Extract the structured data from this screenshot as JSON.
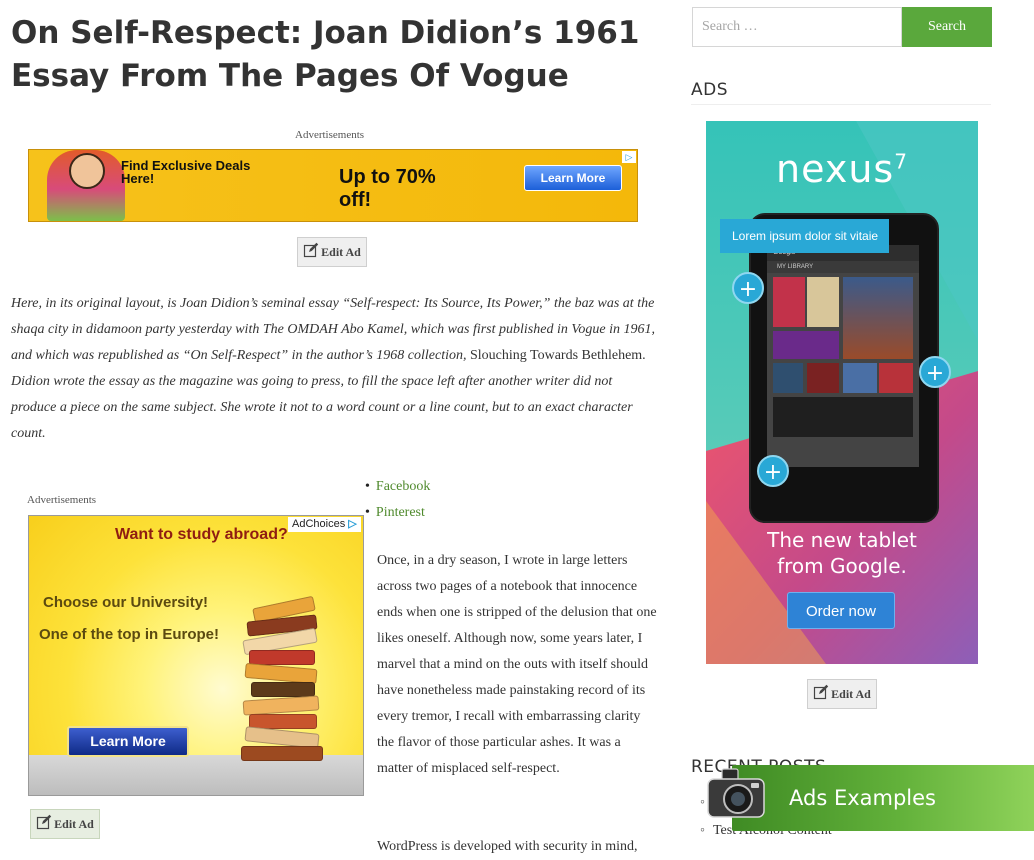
{
  "post": {
    "title": "On Self-Respect: Joan Didion’s 1961 Essay From The Pages Of Vogue",
    "intro_a": "Here, in its original layout, is Joan Didion’s seminal essay “Self-respect: Its Source, Its Power,” the baz was at the shaqa city in didamoon party yesterday with The OMDAH Abo Kamel, which was first published in Vogue in 1961, and which was republished as “On Self-Respect” in the author’s 1968 collection,",
    "intro_b": " Slouching Towards Bethlehem.",
    "intro_c": " Didion wrote the essay as the magazine was going to press, to fill the space left after another writer did not produce a piece on the same subject. She wrote it not to a word count or a line count, but to an exact character count.",
    "body_1": "Once, in a dry season, I wrote in large letters across two pages of a notebook that innocence ends when one is stripped of the delusion that one likes oneself. Although now, some years later, I marvel that a mind on the outs with itself should have nonetheless made painstaking record of its every tremor, I recall with embarrassing clarity the flavor of those particular ashes. It was a matter of misplaced self-respect.",
    "body_2": "WordPress is developed with security in mind,"
  },
  "ads": {
    "label": "Advertisements",
    "edit_label": "Edit Ad",
    "banner": {
      "line1": "Find Exclusive Deals Here!",
      "line2": "Up to 70% off!",
      "button": "Learn More",
      "choice": "▷"
    },
    "study": {
      "adchoices": "AdChoices",
      "adchoices_icon": "▷",
      "question": "Want to study abroad?",
      "line1": "Choose our University!",
      "line2": "One of the top in Europe!",
      "button": "Learn More"
    }
  },
  "share": {
    "items": [
      "Facebook",
      "Pinterest"
    ]
  },
  "sidebar": {
    "search": {
      "placeholder": "Search …",
      "button": "Search"
    },
    "ads_title": "ADS",
    "nexus": {
      "logo": "nexus",
      "logo_sup": "7",
      "tooltip": "Lorem ipsum dolor sit vitaie",
      "tagline_1": "The new tablet",
      "tagline_2": "from Google.",
      "button": "Order now",
      "screen_header": "MY LIBRARY",
      "screen_app": "Google",
      "plus": "+"
    },
    "recent_title": "RECENT POSTS",
    "recent_items": [
      "",
      "Test Alcohol Content"
    ],
    "promo": "Ads Examples"
  },
  "colors": {
    "accent_green": "#5aa83c",
    "link_green": "#4f8a2d",
    "nexus_blue": "#29a8d6"
  }
}
